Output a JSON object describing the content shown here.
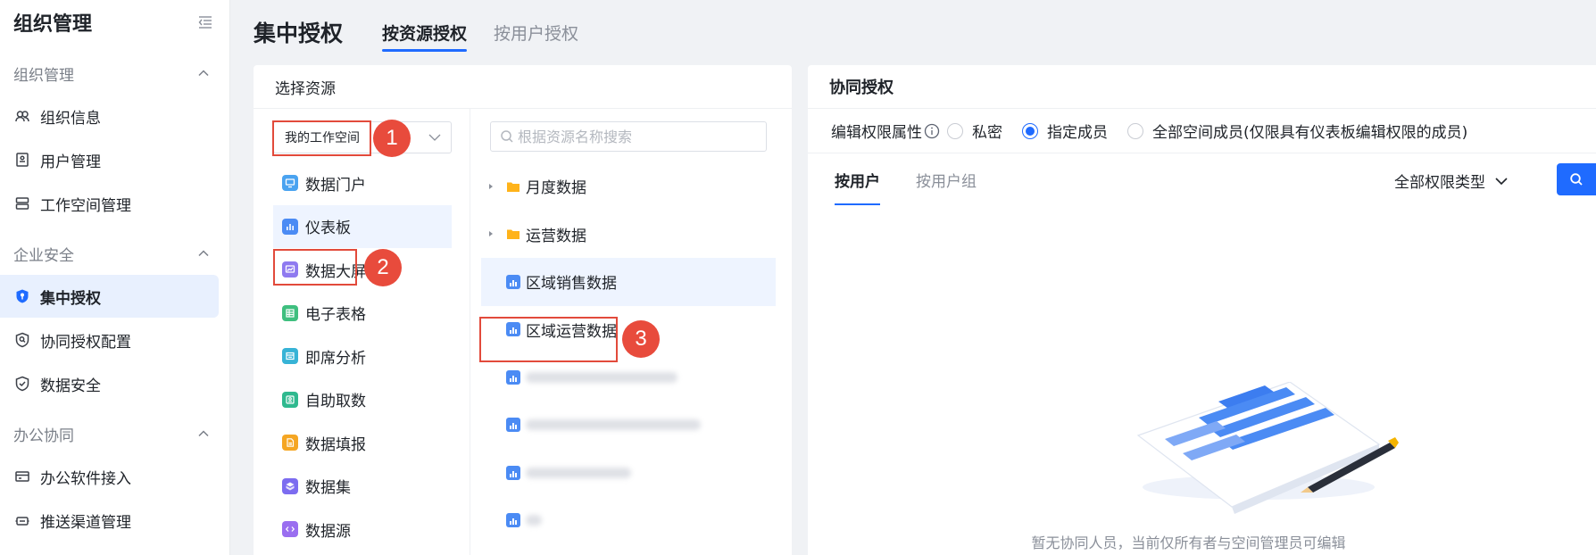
{
  "sidebar": {
    "title": "组织管理",
    "groups": [
      {
        "label": "组织管理",
        "items": [
          "组织信息",
          "用户管理",
          "工作空间管理"
        ]
      },
      {
        "label": "企业安全",
        "items": [
          "集中授权",
          "协同授权配置",
          "数据安全"
        ]
      },
      {
        "label": "办公协同",
        "items": [
          "办公软件接入",
          "推送渠道管理"
        ]
      }
    ],
    "active_item": "集中授权"
  },
  "header": {
    "title": "集中授权",
    "tabs": [
      "按资源授权",
      "按用户授权"
    ],
    "active_tab": "按资源授权"
  },
  "resource_panel": {
    "title": "选择资源",
    "workspace_select": "我的工作空间",
    "search_placeholder": "根据资源名称搜索",
    "types": [
      "数据门户",
      "仪表板",
      "数据大屏",
      "电子表格",
      "即席分析",
      "自助取数",
      "数据填报",
      "数据集",
      "数据源"
    ],
    "active_type": "仪表板",
    "tree": {
      "folders": [
        "月度数据",
        "运营数据"
      ],
      "dashboards": [
        "区域销售数据",
        "区域运营数据"
      ],
      "selected": "区域销售数据"
    }
  },
  "annotations": [
    "1",
    "2",
    "3"
  ],
  "collab_panel": {
    "title": "协同授权",
    "edit_label": "编辑权限属性",
    "options": [
      "私密",
      "指定成员",
      "全部空间成员(仅限具有仪表板编辑权限的成员)"
    ],
    "selected_option": "指定成员",
    "tabs": [
      "按用户",
      "按用户组"
    ],
    "active_tab": "按用户",
    "permission_filter": "全部权限类型",
    "empty_text": "暂无协同人员，当前仅所有者与空间管理员可编辑"
  },
  "colors": {
    "accent": "#1f6bff",
    "annotation_red": "#e84b3c",
    "active_bg": "#eef4ff"
  }
}
